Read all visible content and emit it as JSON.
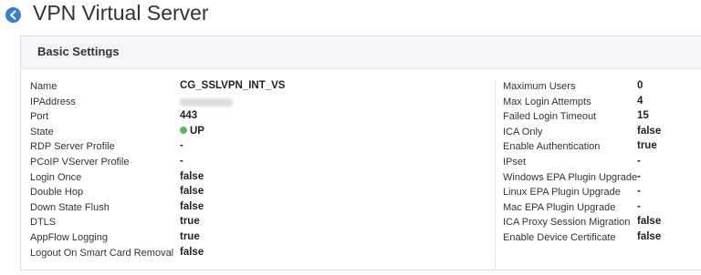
{
  "header": {
    "title": "VPN Virtual Server",
    "back_icon": "arrow-left-circle-icon"
  },
  "panel": {
    "title": "Basic Settings"
  },
  "left_settings": [
    {
      "label": "Name",
      "value": "CG_SSLVPN_INT_VS"
    },
    {
      "label": "IPAddress",
      "value": ""
    },
    {
      "label": "Port",
      "value": "443"
    },
    {
      "label": "State",
      "value": "UP"
    },
    {
      "label": "RDP Server Profile",
      "value": "-"
    },
    {
      "label": "PCoIP VServer Profile",
      "value": "-"
    },
    {
      "label": "Login Once",
      "value": "false"
    },
    {
      "label": "Double Hop",
      "value": "false"
    },
    {
      "label": "Down State Flush",
      "value": "false"
    },
    {
      "label": "DTLS",
      "value": "true"
    },
    {
      "label": "AppFlow Logging",
      "value": "true"
    },
    {
      "label": "Logout On Smart Card Removal",
      "value": "false"
    }
  ],
  "right_settings": [
    {
      "label": "Maximum Users",
      "value": "0"
    },
    {
      "label": "Max Login Attempts",
      "value": "4"
    },
    {
      "label": "Failed Login Timeout",
      "value": "15"
    },
    {
      "label": "ICA Only",
      "value": "false"
    },
    {
      "label": "Enable Authentication",
      "value": "true"
    },
    {
      "label": "IPset",
      "value": "-"
    },
    {
      "label": "Windows EPA Plugin Upgrade",
      "value": "-"
    },
    {
      "label": "Linux EPA Plugin Upgrade",
      "value": "-"
    },
    {
      "label": "Mac EPA Plugin Upgrade",
      "value": "-"
    },
    {
      "label": "ICA Proxy Session Migration",
      "value": "false"
    },
    {
      "label": "Enable Device Certificate",
      "value": "false"
    }
  ],
  "colors": {
    "accent": "#3b7fc4",
    "status_up": "#5cb85c"
  }
}
